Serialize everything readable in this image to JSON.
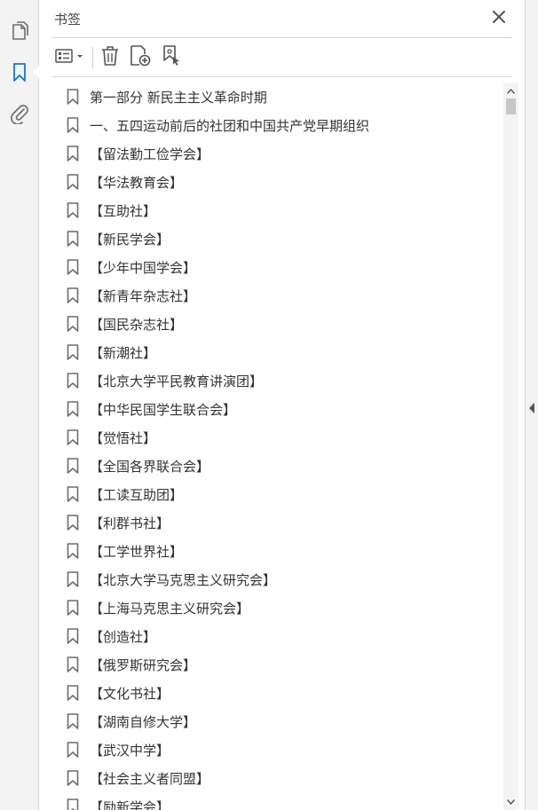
{
  "left_rail": {
    "pages_icon": "pages-icon",
    "bookmarks_icon": "bookmark-icon",
    "attachments_icon": "paperclip-icon",
    "active_color": "#1473e6",
    "icon_color": "#6d6d6d"
  },
  "panel": {
    "title": "书签",
    "close_icon": "close-icon"
  },
  "toolbar": {
    "options_icon": "list-options-icon",
    "delete_icon": "trash-icon",
    "new_bookmark_icon": "new-bookmark-icon",
    "bookmark_from_selection_icon": "bookmark-cursor-icon"
  },
  "bookmarks": [
    {
      "label": "第一部分  新民主主义革命时期"
    },
    {
      "label": "一、五四运动前后的社团和中国共产党早期组织"
    },
    {
      "label": "【留法勤工俭学会】"
    },
    {
      "label": "【华法教育会】"
    },
    {
      "label": "【互助社】"
    },
    {
      "label": "【新民学会】"
    },
    {
      "label": "【少年中国学会】"
    },
    {
      "label": "【新青年杂志社】"
    },
    {
      "label": "【国民杂志社】"
    },
    {
      "label": "【新潮社】"
    },
    {
      "label": "【北京大学平民教育讲演团】"
    },
    {
      "label": "【中华民国学生联合会】"
    },
    {
      "label": "【觉悟社】"
    },
    {
      "label": "【全国各界联合会】"
    },
    {
      "label": "【工读互助团】"
    },
    {
      "label": "【利群书社】"
    },
    {
      "label": "【工学世界社】"
    },
    {
      "label": "【北京大学马克思主义研究会】"
    },
    {
      "label": "【上海马克思主义研究会】"
    },
    {
      "label": "【创造社】"
    },
    {
      "label": "【俄罗斯研究会】"
    },
    {
      "label": "【文化书社】"
    },
    {
      "label": "【湖南自修大学】"
    },
    {
      "label": "【武汉中学】"
    },
    {
      "label": "【社会主义者同盟】"
    },
    {
      "label": "【励新学会】"
    }
  ],
  "scrollbar": {
    "up_icon": "scroll-up-icon",
    "down_icon": "scroll-down-icon"
  },
  "right_strip": {
    "collapse_icon": "collapse-left-icon"
  }
}
